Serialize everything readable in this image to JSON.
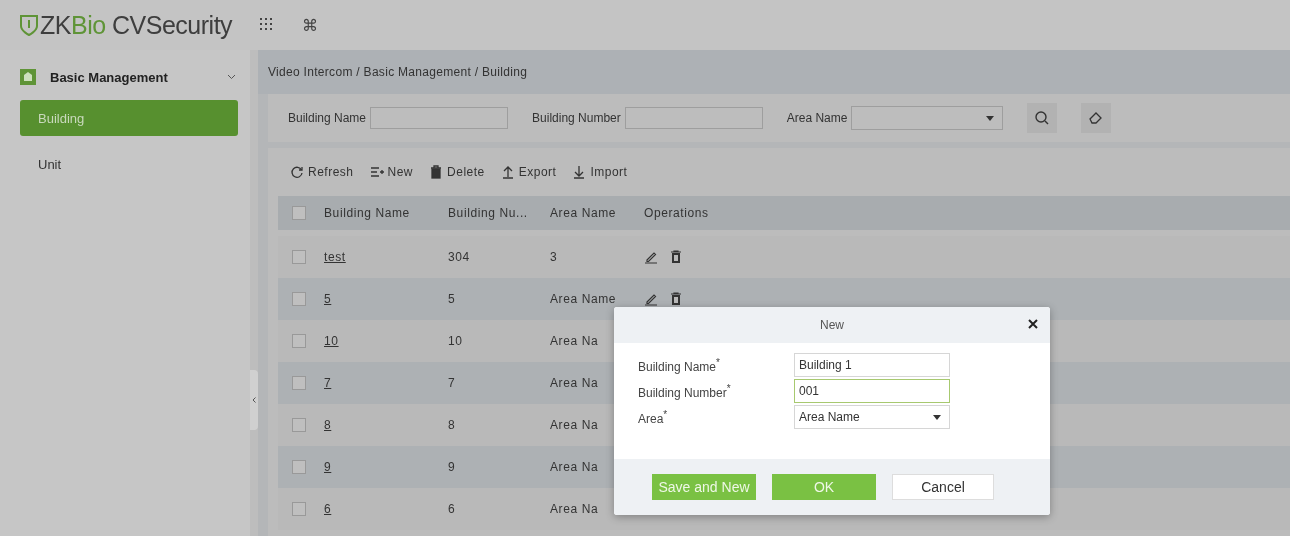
{
  "header": {
    "logo_parts": [
      {
        "text": "ZK",
        "accent": false
      },
      {
        "text": "Bio",
        "accent": true
      },
      {
        "text": " CVSecurity",
        "accent": false
      }
    ],
    "shortcut_icon": "⌘"
  },
  "sidebar": {
    "group": {
      "label": "Basic Management",
      "expanded": true
    },
    "items": [
      {
        "label": "Building",
        "selected": true
      },
      {
        "label": "Unit",
        "selected": false
      }
    ]
  },
  "breadcrumb": "Video Intercom / Basic Management / Building",
  "filters": [
    {
      "label": "Building Name",
      "kind": "text"
    },
    {
      "label": "Building Number",
      "kind": "text"
    },
    {
      "label": "Area Name",
      "kind": "select"
    }
  ],
  "toolbar": [
    {
      "label": "Refresh"
    },
    {
      "label": "New"
    },
    {
      "label": "Delete"
    },
    {
      "label": "Export"
    },
    {
      "label": "Import"
    }
  ],
  "table": {
    "columns": [
      "Building Name",
      "Building Nu...",
      "Area Name",
      "Operations"
    ],
    "all_checked": false,
    "rows": [
      {
        "checked": false,
        "name": "test",
        "number": "304",
        "area": "3",
        "actions_visible": true
      },
      {
        "checked": false,
        "name": "5",
        "number": "5",
        "area": "Area Name",
        "actions_visible": true
      },
      {
        "checked": false,
        "name": "10",
        "number": "10",
        "area": "Area Na"
      },
      {
        "checked": false,
        "name": "7",
        "number": "7",
        "area": "Area Na"
      },
      {
        "checked": false,
        "name": "8",
        "number": "8",
        "area": "Area Na"
      },
      {
        "checked": false,
        "name": "9",
        "number": "9",
        "area": "Area Na"
      },
      {
        "checked": false,
        "name": "6",
        "number": "6",
        "area": "Area Na"
      }
    ]
  },
  "dialog": {
    "title": "New",
    "fields": [
      {
        "label": "Building Name$^{*}$",
        "kind": "text",
        "value": "Building 1",
        "focused": false
      },
      {
        "label": "Building Number$^{*}$",
        "kind": "text",
        "value": "001",
        "focused": true
      },
      {
        "label": "Area$^{*}$",
        "kind": "select",
        "value": "Area Name",
        "focused": false
      }
    ],
    "buttons": [
      {
        "label": "Save and New",
        "kind": "primary"
      },
      {
        "label": "OK",
        "kind": "primary"
      },
      {
        "label": "Cancel",
        "kind": "secondary"
      }
    ]
  }
}
